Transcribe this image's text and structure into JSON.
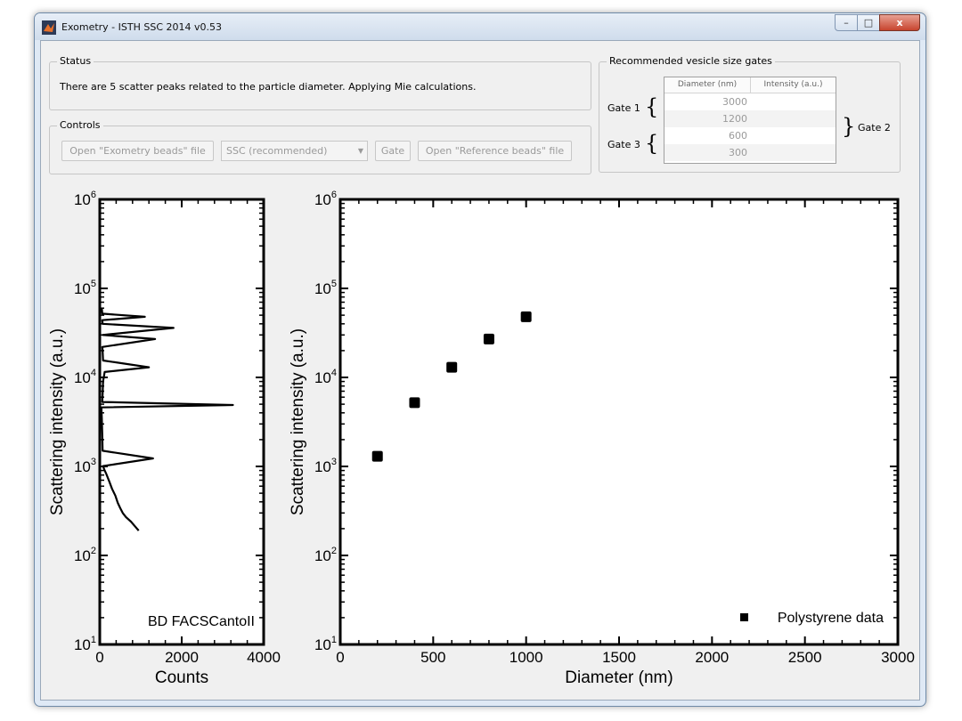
{
  "window": {
    "title": "Exometry - ISTH SSC 2014 v0.53",
    "controls": {
      "minimize": "–",
      "maximize": "□",
      "close": "x"
    }
  },
  "status": {
    "legend": "Status",
    "message": "There are 5 scatter peaks related to the particle diameter. Applying Mie calculations."
  },
  "controls": {
    "legend": "Controls",
    "open_exometry_label": "Open \"Exometry beads\" file",
    "ssc_select_value": "SSC (recommended)",
    "gate_label": "Gate",
    "open_reference_label": "Open \"Reference beads\" file"
  },
  "gates": {
    "legend": "Recommended vesicle size gates",
    "columns": [
      "Diameter (nm)",
      "Intensity (a.u.)"
    ],
    "rows": [
      {
        "diameter": "3000",
        "intensity": ""
      },
      {
        "diameter": "1200",
        "intensity": ""
      },
      {
        "diameter": "600",
        "intensity": ""
      },
      {
        "diameter": "300",
        "intensity": ""
      }
    ],
    "gate1": "Gate 1",
    "gate2": "Gate 2",
    "gate3": "Gate 3"
  },
  "chart_data": [
    {
      "type": "line",
      "title": "",
      "xlabel": "Counts",
      "ylabel": "Scattering intensity (a.u.)",
      "annotation": "BD FACSCantoII",
      "xlim": [
        0,
        4000
      ],
      "xticks": [
        0,
        2000,
        4000
      ],
      "ylim": [
        10,
        1000000
      ],
      "yscale": "log",
      "yticks": [
        "10^1",
        "10^2",
        "10^3",
        "10^4",
        "10^5",
        "10^6"
      ],
      "series": [
        {
          "x": [
            950,
            870,
            760,
            640,
            560,
            500,
            440,
            380,
            300,
            230,
            160,
            110,
            80,
            1300,
            70,
            60,
            50,
            40,
            3250,
            60,
            70,
            80,
            120,
            1200,
            80,
            70,
            60,
            1350,
            70,
            1800,
            70,
            60,
            1100,
            60,
            50
          ],
          "y": [
            190,
            210,
            240,
            270,
            300,
            340,
            390,
            470,
            560,
            680,
            820,
            920,
            1010,
            1230,
            1500,
            2300,
            3500,
            4600,
            4900,
            5300,
            6500,
            9000,
            11500,
            13000,
            15500,
            20000,
            22000,
            27000,
            30000,
            36000,
            40000,
            44000,
            48000,
            52000,
            60000
          ]
        }
      ]
    },
    {
      "type": "scatter",
      "title": "",
      "xlabel": "Diameter (nm)",
      "ylabel": "Scattering intensity (a.u.)",
      "xlim": [
        0,
        3000
      ],
      "xticks": [
        0,
        500,
        1000,
        1500,
        2000,
        2500,
        3000
      ],
      "ylim": [
        10,
        1000000
      ],
      "yscale": "log",
      "yticks": [
        "10^1",
        "10^2",
        "10^3",
        "10^4",
        "10^5",
        "10^6"
      ],
      "legend_position": "bottom-right",
      "series": [
        {
          "name": "Polystyrene data",
          "x": [
            200,
            400,
            600,
            800,
            1000
          ],
          "y": [
            1300,
            5200,
            13000,
            27000,
            48000
          ]
        }
      ]
    }
  ]
}
